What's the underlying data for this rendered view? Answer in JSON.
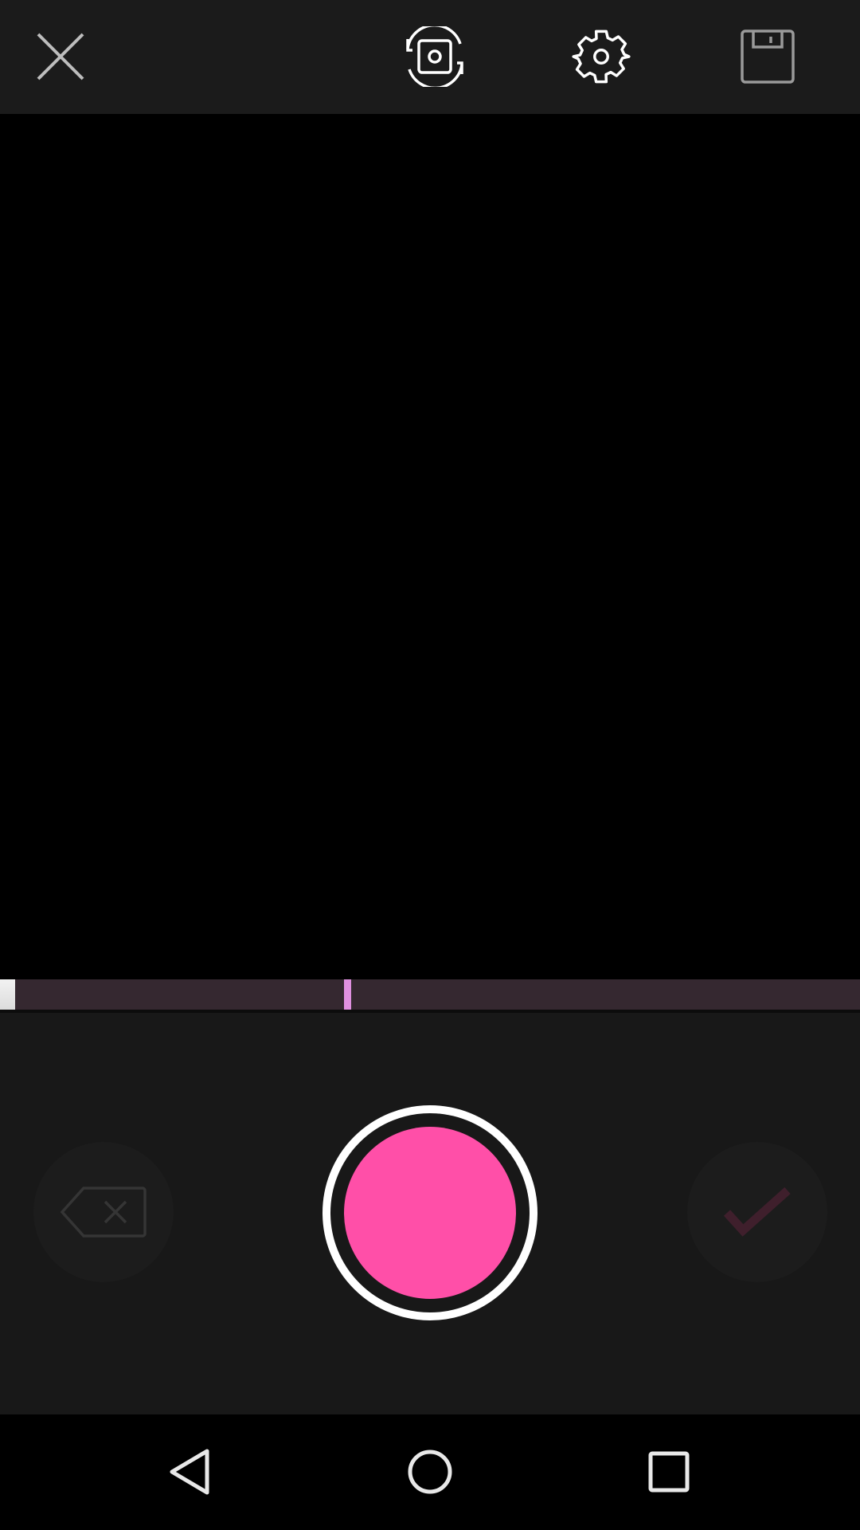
{
  "colors": {
    "top_bar": "#1b1b1b",
    "controls_bg": "#181818",
    "record_fill": "#ff4fa8",
    "progress_track": "#352830",
    "progress_marker": "#e090e0",
    "confirm_check": "#3f1f2c",
    "delete_icon": "#353535"
  },
  "toolbar": {
    "icons": [
      "close-icon",
      "switch-camera-icon",
      "gear-icon",
      "save-icon"
    ]
  },
  "recording": {
    "recorded_fraction": 0.018,
    "minimum_marker_fraction": 0.4
  },
  "controls": {
    "icons": [
      "backspace-delete-icon",
      "record-button",
      "check-icon"
    ]
  },
  "navbar": {
    "icons": [
      "back-icon",
      "home-icon",
      "recents-icon"
    ]
  }
}
